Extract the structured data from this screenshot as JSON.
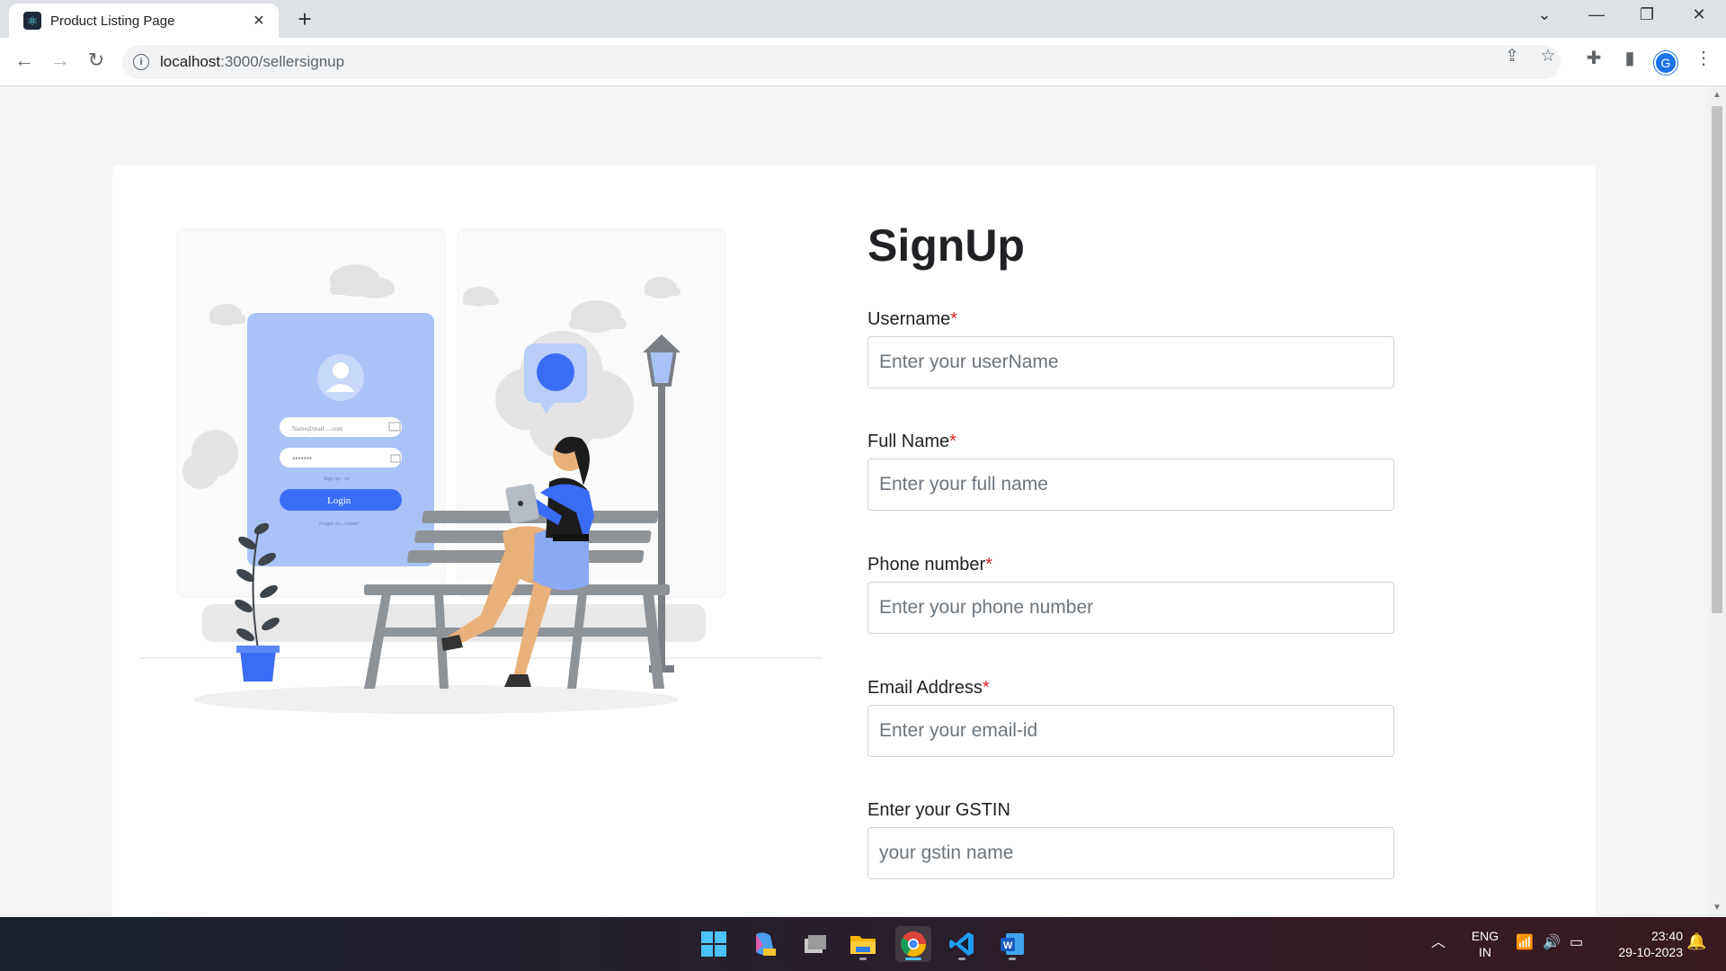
{
  "browser": {
    "tab_title": "Product Listing Page",
    "tab_close": "✕",
    "new_tab": "+",
    "url_host": "localhost",
    "url_path": ":3000/sellersignup",
    "profile_initial": "G"
  },
  "page": {
    "title": "SignUp",
    "fields": [
      {
        "label": "Username",
        "required": "*",
        "placeholder": "Enter your userName"
      },
      {
        "label": "Full Name",
        "required": "*",
        "placeholder": "Enter your full name"
      },
      {
        "label": "Phone number",
        "required": "*",
        "placeholder": "Enter your phone number"
      },
      {
        "label": "Email Address",
        "required": "*",
        "placeholder": "Enter your email-id"
      },
      {
        "label": "Enter your GSTIN",
        "required": "",
        "placeholder": "your gstin name"
      }
    ],
    "illustration": {
      "email_placeholder": "Name@mail.....com",
      "password_mask": "•••••••",
      "signup_hint": "Sign up · or",
      "login_button": "Login",
      "forgot_hint": "Forgot Ac...count?"
    }
  },
  "taskbar": {
    "language": "ENG",
    "region": "IN",
    "time": "23:40",
    "date": "29-10-2023"
  },
  "colors": {
    "accent": "#3b6cf6",
    "card_bg": "#ffffff",
    "page_bg": "#f4f4f4",
    "required": "#e02424"
  }
}
